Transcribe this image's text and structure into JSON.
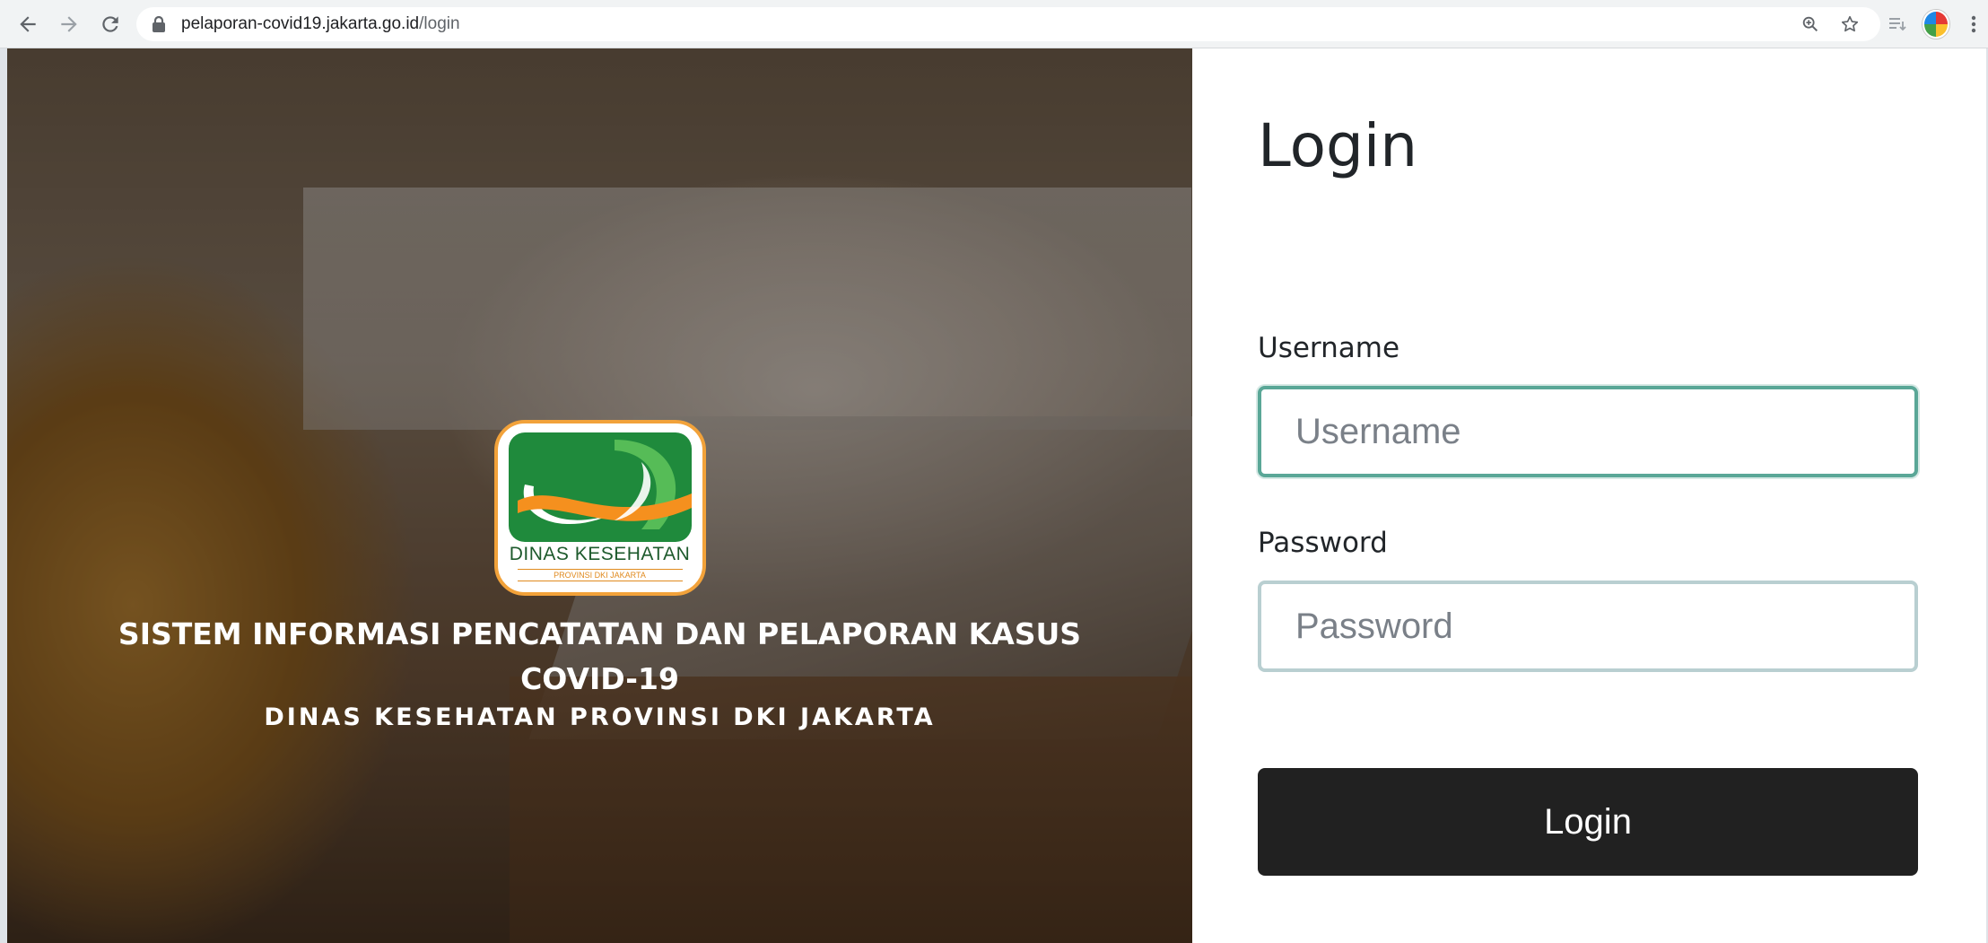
{
  "browser": {
    "url_host": "pelaporan-covid19.jakarta.go.id",
    "url_path": "/login",
    "icons": {
      "back": "back-arrow-icon",
      "forward": "forward-arrow-icon",
      "reload": "reload-icon",
      "lock": "lock-icon",
      "zoom": "zoom-icon",
      "bookmark": "star-icon",
      "reading_list": "reading-list-icon",
      "profile": "avatar",
      "menu": "kebab-menu-icon"
    }
  },
  "hero": {
    "logo": {
      "name": "DINAS KESEHATAN",
      "sub": "PROVINSI DKI JAKARTA"
    },
    "title": "SISTEM INFORMASI PENCATATAN DAN PELAPORAN KASUS COVID-19",
    "subtitle": "DINAS KESEHATAN PROVINSI DKI JAKARTA"
  },
  "login": {
    "title": "Login",
    "username_label": "Username",
    "username_placeholder": "Username",
    "username_value": "",
    "password_label": "Password",
    "password_placeholder": "Password",
    "password_value": "",
    "button_label": "Login"
  },
  "colors": {
    "logo_green": "#1f8a3c",
    "logo_orange": "#f5901e",
    "focus_border": "#5aa797",
    "button_bg": "#212121"
  }
}
